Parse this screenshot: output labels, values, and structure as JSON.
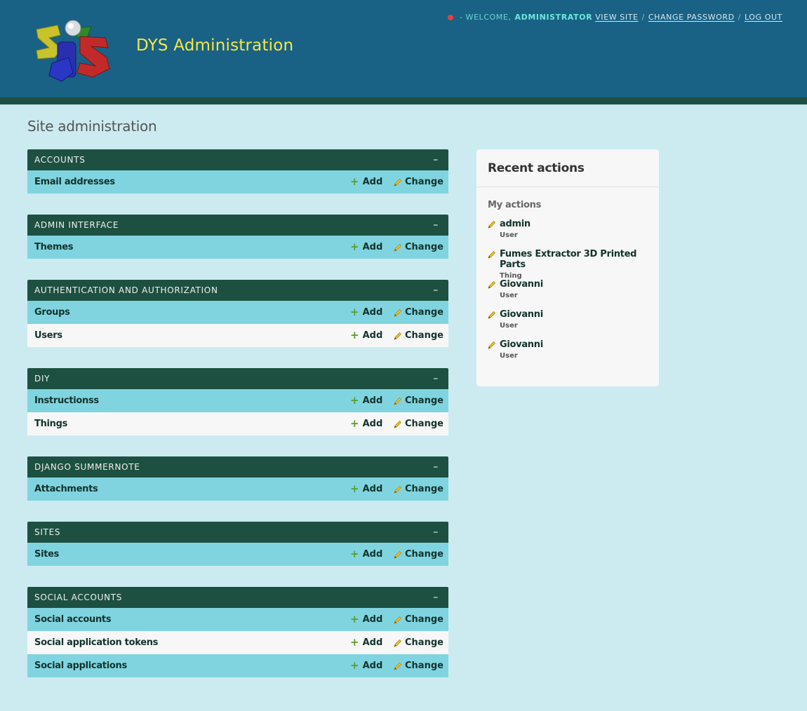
{
  "header": {
    "site_title": "DYS Administration",
    "logo_text": "DYS",
    "welcome": "- WELCOME,",
    "username": "ADMINISTRATOR",
    "view_site": "VIEW SITE",
    "change_password": "CHANGE PASSWORD",
    "log_out": "LOG OUT",
    "separator": "/",
    "status_dot_color": "#e5423c"
  },
  "page_title": "Site administration",
  "labels": {
    "add": "Add",
    "change": "Change",
    "collapse": "–"
  },
  "modules": [
    {
      "caption": "ACCOUNTS",
      "models": [
        "Email addresses"
      ]
    },
    {
      "caption": "ADMIN INTERFACE",
      "models": [
        "Themes"
      ]
    },
    {
      "caption": "AUTHENTICATION AND AUTHORIZATION",
      "models": [
        "Groups",
        "Users"
      ]
    },
    {
      "caption": "DIY",
      "models": [
        "Instructionss",
        "Things"
      ]
    },
    {
      "caption": "DJANGO SUMMERNOTE",
      "models": [
        "Attachments"
      ]
    },
    {
      "caption": "SITES",
      "models": [
        "Sites"
      ]
    },
    {
      "caption": "SOCIAL ACCOUNTS",
      "models": [
        "Social accounts",
        "Social application tokens",
        "Social applications"
      ]
    }
  ],
  "recent_actions": {
    "title": "Recent actions",
    "subtitle": "My actions",
    "items": [
      {
        "name": "admin",
        "type": "User"
      },
      {
        "name": "Fumes Extractor 3D Printed Parts",
        "type": "Thing"
      },
      {
        "name": "Giovanni",
        "type": "User"
      },
      {
        "name": "Giovanni",
        "type": "User"
      },
      {
        "name": "Giovanni",
        "type": "User"
      }
    ]
  },
  "colors": {
    "header_bg": "#196285",
    "module_caption_bg": "#1d5040",
    "row_odd_bg": "#80d4e0",
    "page_bg": "#cbebf0",
    "title_color": "#f4e848"
  }
}
